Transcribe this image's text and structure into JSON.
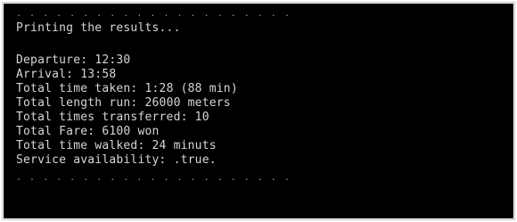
{
  "terminal": {
    "top_partial": ". . . . . . . . . . . . . . . . . . . . .",
    "header": "Printing the results...",
    "results": [
      {
        "label": "Departure:",
        "value": "12:30"
      },
      {
        "label": "Arrival:",
        "value": "13:58"
      },
      {
        "label": "Total time taken:",
        "value": "1:28 (88 min)"
      },
      {
        "label": "Total length run:",
        "value": "26000 meters"
      },
      {
        "label": "Total times transferred:",
        "value": "10"
      },
      {
        "label": "Total Fare:",
        "value": "6100 won"
      },
      {
        "label": "Total time walked:",
        "value": "24 minuts"
      },
      {
        "label": "Service availability:",
        "value": ".true."
      }
    ],
    "bottom_partial": ". . . . . . . . . . . . . . . . . . . . ."
  },
  "colors": {
    "background": "#000000",
    "text": "#d6d6d6"
  }
}
